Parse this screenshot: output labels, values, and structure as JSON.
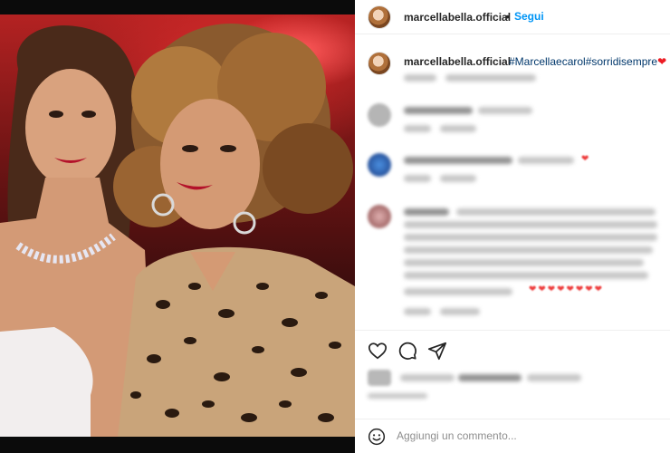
{
  "post": {
    "username": "marcellabella.official",
    "follow_label": "Segui",
    "dot": "•",
    "caption_hashtags": "#Marcellaecarol#sorridisempre",
    "caption_heart": "❤",
    "caption_meta": "",
    "comment_placeholder": "Aggiungi un commento..."
  },
  "comments": [
    {
      "hearts": ""
    },
    {
      "hearts": "❤"
    },
    {
      "hearts": "❤❤❤❤❤❤❤❤"
    }
  ],
  "icons": [
    "heart-icon",
    "comment-icon",
    "share-icon",
    "emoji-icon"
  ],
  "colors": {
    "accent": "#0095f6",
    "link": "#00376b",
    "heart": "#ed1c24"
  }
}
